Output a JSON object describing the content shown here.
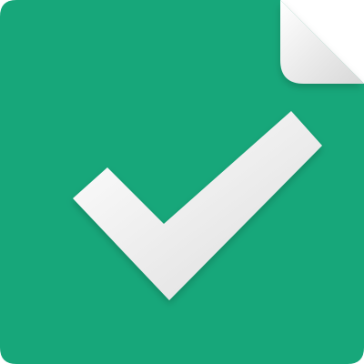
{
  "icon": {
    "name": "document-check-icon",
    "colors": {
      "background": "#ffffff",
      "document": "#17a77a",
      "fold_light": "#ffffff",
      "fold_shadow": "#d8d8d8",
      "check_light": "#ffffff",
      "check_shadow": "#dcdcdc"
    }
  }
}
